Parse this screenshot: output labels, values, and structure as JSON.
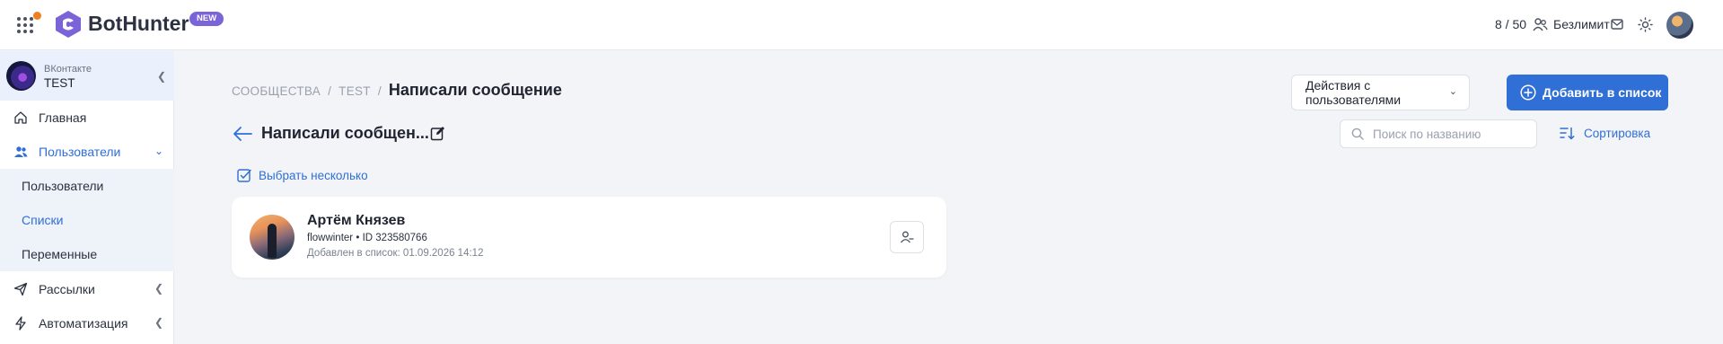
{
  "header": {
    "brand": "BotHunter",
    "badge": "NEW",
    "counter": "8 / 50",
    "plan": "Безлимит",
    "icons": [
      "apps-grid-icon",
      "logo-icon",
      "users-icon",
      "mail-icon",
      "sun-icon"
    ],
    "notification_color": "#f07f24"
  },
  "sidebar": {
    "group": {
      "network": "ВКонтакте",
      "name": "TEST"
    },
    "items": [
      {
        "label": "Главная",
        "icon": "home-icon"
      },
      {
        "label": "Пользователи",
        "icon": "users-icon",
        "expanded": true
      },
      {
        "label": "Пользователи"
      },
      {
        "label": "Списки",
        "active": true
      },
      {
        "label": "Переменные"
      },
      {
        "label": "Рассылки",
        "icon": "send-icon"
      },
      {
        "label": "Автоматизация",
        "icon": "bolt-icon"
      }
    ]
  },
  "breadcrumb": {
    "items": [
      "СООБЩЕСТВА",
      "TEST"
    ],
    "separator": "/",
    "current": "Написали сообщение"
  },
  "list": {
    "title": "Написали сообщен...",
    "select_many": "Выбрать несколько",
    "search_placeholder": "Поиск по названию",
    "sort_label": "Сортировка"
  },
  "toolbar": {
    "actions_label": "Действия с пользователями",
    "add_label": "Добавить в список"
  },
  "users": [
    {
      "name": "Артём Князев",
      "username": "flowwinter",
      "bullet": "•",
      "id_text": "ID 323580766",
      "added": "Добавлен в список: 01.09.2026 14:12"
    }
  ],
  "colors": {
    "accent": "#2f6fd6",
    "badge": "#7b63d8",
    "background": "#f3f4f8"
  }
}
